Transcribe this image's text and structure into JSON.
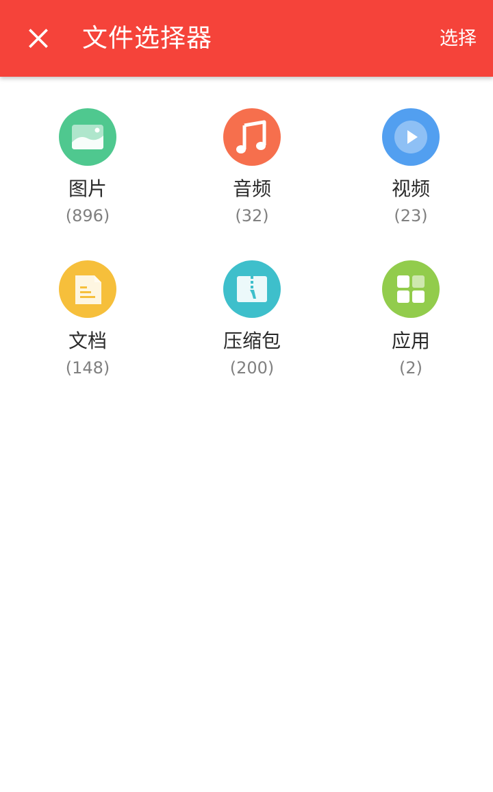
{
  "appbar": {
    "title": "文件选择器",
    "select_label": "选择",
    "close_icon": "close-icon",
    "background": "#f5433a"
  },
  "categories": [
    {
      "label": "图片",
      "count": "(896)",
      "icon": "image-icon",
      "color": "#4fc88f"
    },
    {
      "label": "音频",
      "count": "(32)",
      "icon": "music-note-icon",
      "color": "#f66f4d"
    },
    {
      "label": "视频",
      "count": "(23)",
      "icon": "play-icon",
      "color": "#529ff0"
    },
    {
      "label": "文档",
      "count": "(148)",
      "icon": "document-icon",
      "color": "#f6bf3b"
    },
    {
      "label": "压缩包",
      "count": "(200)",
      "icon": "zip-icon",
      "color": "#3ebfcb"
    },
    {
      "label": "应用",
      "count": "(2)",
      "icon": "apps-icon",
      "color": "#92cc4c"
    }
  ]
}
